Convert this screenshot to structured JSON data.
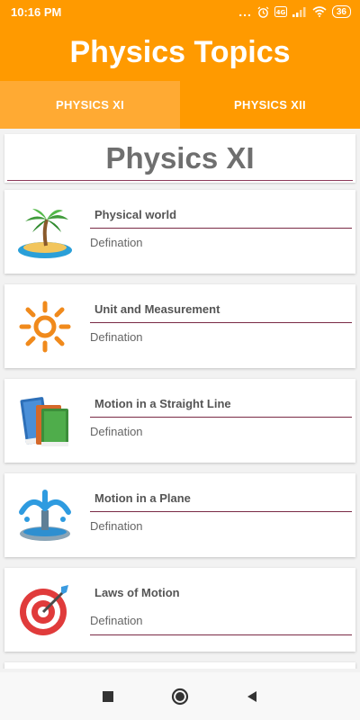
{
  "status_bar": {
    "time": "10:16 PM",
    "dots": "...",
    "battery": "36",
    "icons": [
      "alarm-icon",
      "volte-icon",
      "signal-icon",
      "wifi-icon",
      "battery-icon"
    ]
  },
  "header": {
    "title": "Physics Topics"
  },
  "tabs": [
    {
      "label": "PHYSICS XI",
      "active": true
    },
    {
      "label": "PHYSICS XII",
      "active": false
    }
  ],
  "section": {
    "title": "Physics XI"
  },
  "topics": [
    {
      "title": "Physical world",
      "subtitle": "Defination",
      "icon": "island-icon"
    },
    {
      "title": "Unit and Measurement",
      "subtitle": "Defination",
      "icon": "sun-icon"
    },
    {
      "title": "Motion in a Straight Line",
      "subtitle": "Defination",
      "icon": "books-icon"
    },
    {
      "title": "Motion in a Plane",
      "subtitle": "Defination",
      "icon": "fountain-icon"
    },
    {
      "title": "Laws of Motion",
      "subtitle": "Defination",
      "icon": "target-icon"
    }
  ],
  "colors": {
    "primary": "#ff9a00",
    "tab_active": "#ffaa33",
    "divider": "#7a2a45"
  }
}
